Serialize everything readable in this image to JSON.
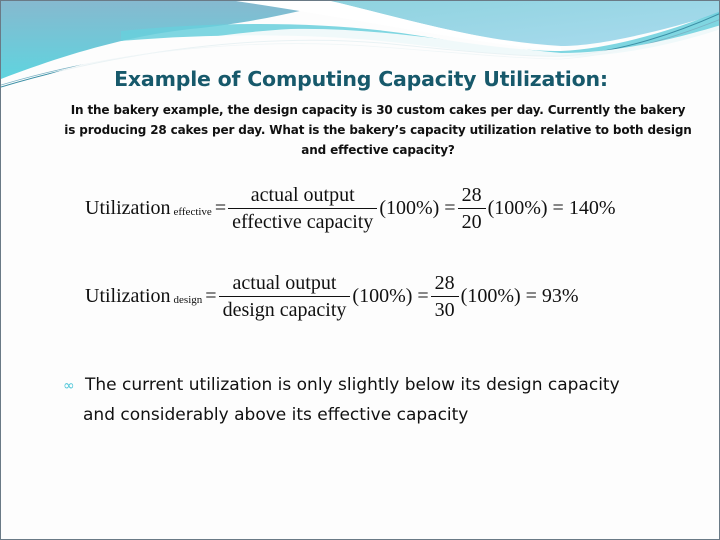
{
  "slide": {
    "title": "Example of Computing Capacity Utilization:",
    "intro_lines": [
      "In the bakery example, the design capacity is 30 custom cakes per day.  Currently the bakery",
      "is producing 28 cakes per day. What is the bakery’s capacity utilization relative to both design",
      "and effective capacity?"
    ],
    "equations": {
      "effective": {
        "lhs": "Utilization",
        "subscript": "effective",
        "eq1": "=",
        "numerator": "actual  output",
        "denominator": "effective  capacity",
        "factor1": "(100%) =",
        "num_value": "28",
        "den_value": "20",
        "factor2": "(100%) = 140%"
      },
      "design": {
        "lhs": "Utilization",
        "subscript": "design",
        "eq1": "=",
        "numerator": "actual  output",
        "denominator": "design  capacity",
        "factor1": "(100%) =",
        "num_value": "28",
        "den_value": "30",
        "factor2": "(100%) = 93%"
      }
    },
    "bullet": {
      "icon": "curl-bullet-icon",
      "line1": "The current utilization is only slightly below its design capacity",
      "line2": "and considerably above its effective capacity"
    },
    "colors": {
      "title": "#17596b",
      "bullet_icon": "#4cc6d8",
      "wave_dark": "#7fbcd0",
      "wave_light": "#a9dde6"
    }
  }
}
